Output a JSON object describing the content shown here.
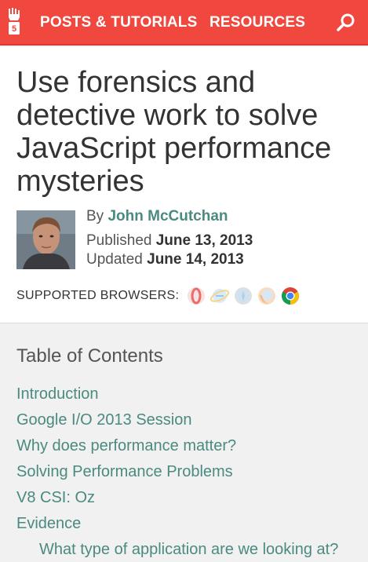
{
  "header": {
    "nav": [
      {
        "label": "POSTS & TUTORIALS"
      },
      {
        "label": "RESOURCES"
      }
    ],
    "icons": {
      "logo": "html5-rocks-logo-icon",
      "search": "search-icon"
    },
    "accent_color": "#f0483e"
  },
  "article": {
    "title": "Use forensics and detective work to solve JavaScript performance mysteries",
    "by_prefix": "By",
    "author": "John McCutchan",
    "published_label": "Published",
    "published_date": "June 13, 2013",
    "updated_label": "Updated",
    "updated_date": "June 14, 2013",
    "supported_browsers_label": "SUPPORTED BROWSERS:",
    "browsers": [
      "opera",
      "internet-explorer",
      "safari",
      "firefox",
      "chrome"
    ],
    "link_color": "#4a8a80"
  },
  "toc": {
    "heading": "Table of Contents",
    "items": [
      {
        "label": "Introduction"
      },
      {
        "label": "Google I/O 2013 Session"
      },
      {
        "label": "Why does performance matter?"
      },
      {
        "label": "Solving Performance Problems"
      },
      {
        "label": "V8 CSI: Oz"
      },
      {
        "label": "Evidence"
      },
      {
        "label": "What type of application are we looking at?"
      }
    ]
  }
}
